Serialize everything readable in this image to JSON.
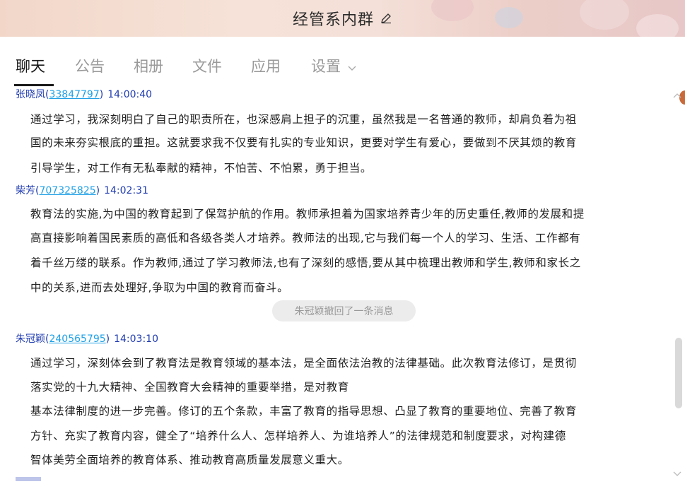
{
  "header": {
    "title": "经管系内群",
    "edit_icon": "pencil-icon"
  },
  "tabs": [
    {
      "label": "聊天",
      "active": true
    },
    {
      "label": "公告"
    },
    {
      "label": "相册"
    },
    {
      "label": "文件"
    },
    {
      "label": "应用"
    },
    {
      "label": "设置",
      "has_dropdown": true,
      "dropdown_icon": "chevron-down-icon"
    }
  ],
  "messages": [
    {
      "sender": "张晓凤",
      "uid_open": "(",
      "uid": "33847797",
      "uid_close": ")",
      "time": "14:00:40",
      "lines": [
        "通过学习，我深刻明白了自己的职责所在，也深感肩上担子的沉重，虽然我是一名普通的教师，却肩负着为祖",
        "国的未来夯实根底的重担。这就要求我不仅要有扎实的专业知识，更要对学生有爱心，要做到不厌其烦的教育",
        "引导学生，对工作有无私奉献的精神，不怕苦、不怕累，勇于担当。"
      ]
    },
    {
      "sender": "柴芳",
      "uid_open": "(",
      "uid": "707325825",
      "uid_close": ")",
      "time": "14:02:31",
      "lines": [
        "教育法的实施,为中国的教育起到了保驾护航的作用。教师承担着为国家培养青少年的历史重任,教师的发展和提",
        "高直接影响着国民素质的高低和各级各类人才培养。教师法的出现,它与我们每一个人的学习、生活、工作都有",
        "着千丝万缕的联系。作为教师,通过了学习教师法,也有了深刻的感悟,要从其中梳理出教师和学生,教师和家长之",
        "中的关系,进而去处理好,争取为中国的教育而奋斗。"
      ]
    },
    {
      "sender": "朱冠颖",
      "uid_open": "(",
      "uid": "240565795",
      "uid_close": ")",
      "time": "14:03:10",
      "lines": [
        "通过学习，深刻体会到了教育法是教育领域的基本法，是全面依法治教的法律基础。此次教育法修订，是贯彻",
        "落实党的十九大精神、全国教育大会精神的重要举措，是对教育",
        "基本法律制度的进一步完善。修订的五个条款，丰富了教育的指导思想、凸显了教育的重要地位、完善了教育",
        "方针、充实了教育内容，健全了“培养什么人、怎样培养人、为谁培养人”的法律规范和制度要求，对构建德",
        "智体美劳全面培养的教育体系、推动教育高质量发展意义重大。"
      ]
    }
  ],
  "system_notice": "朱冠颖撤回了一条消息",
  "colors": {
    "sender": "#1f3bb0",
    "uid_link": "#1ea0e6",
    "active_tab": "#1a1a1a",
    "inactive_tab": "#9a9a9a"
  }
}
